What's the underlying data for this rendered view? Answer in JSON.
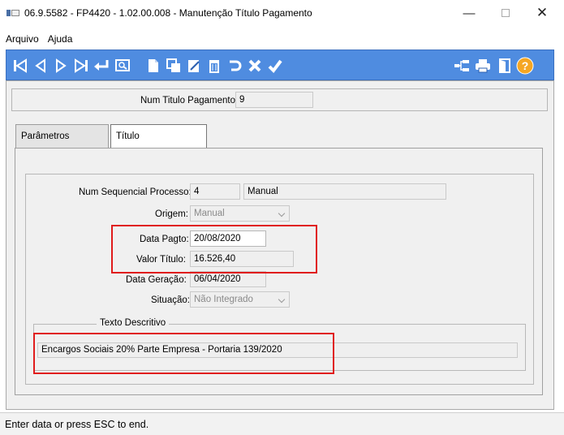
{
  "window": {
    "title": "06.9.5582 - FP4420 - 1.02.00.008 - Manutenção Título Pagamento",
    "min": "—",
    "close": "✕"
  },
  "menu": {
    "items": [
      "Arquivo",
      "Ajuda"
    ]
  },
  "toolbar": {
    "icons": [
      "first-icon",
      "previous-icon",
      "next-icon",
      "last-icon",
      "return-icon",
      "zoom-icon",
      "new-icon",
      "copy-icon",
      "edit-icon",
      "delete-icon",
      "undo-icon",
      "cancel-icon",
      "save-icon",
      "navigate-icon",
      "print-icon",
      "exit-icon",
      "help-icon"
    ],
    "accent": "#4f8ce0"
  },
  "header": {
    "num_titulo_label": "Num Titulo Pagamento:",
    "num_titulo_value": "9"
  },
  "tabs": [
    {
      "label": "Parâmetros"
    },
    {
      "label": "Título"
    }
  ],
  "form": {
    "num_seq_label": "Num Sequencial Processo:",
    "num_seq_value": "4",
    "num_seq_desc": "Manual",
    "origem_label": "Origem:",
    "origem_value": "Manual",
    "data_pagto_label": "Data Pagto:",
    "data_pagto_value": "20/08/2020",
    "valor_label": "Valor Título:",
    "valor_value": "16.526,40",
    "data_geracao_label": "Data Geração:",
    "data_geracao_value": "06/04/2020",
    "situacao_label": "Situação:",
    "situacao_value": "Não Integrado",
    "texto_legend": "Texto Descritivo",
    "texto_value": "Encargos Sociais 20% Parte Empresa - Portaria 139/2020"
  },
  "status": {
    "text": "Enter data or press ESC to end."
  },
  "colors": {
    "highlight": "#e01c1c"
  }
}
